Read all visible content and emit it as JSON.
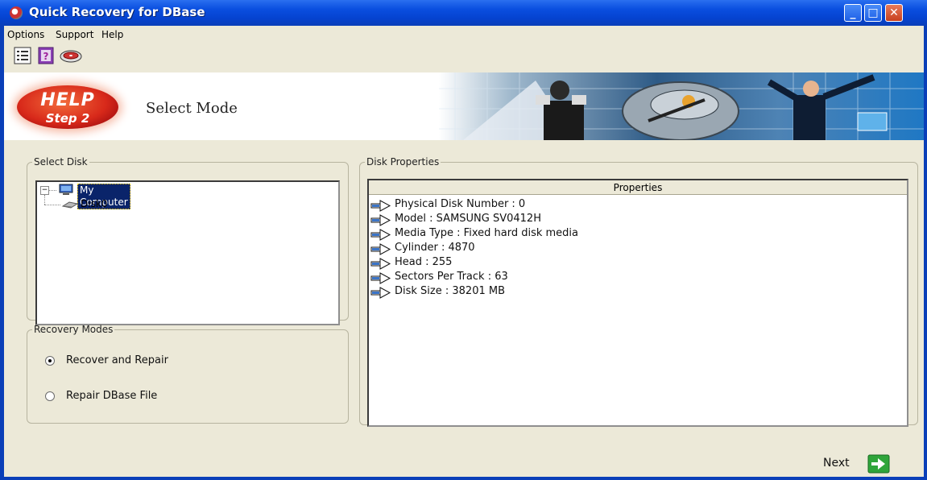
{
  "window": {
    "title": "Quick Recovery for DBase"
  },
  "menu": {
    "items": [
      "Options",
      "Support",
      "Help"
    ]
  },
  "toolbar": {
    "icons": [
      "list-icon",
      "help-book-icon",
      "disk-icon"
    ]
  },
  "banner": {
    "help_word": "HELP",
    "step_word": "Step 2",
    "mode_title": "Select Mode"
  },
  "select_disk": {
    "legend": "Select Disk",
    "tree_root": "My Computer",
    "tree_child": "Disk0"
  },
  "recovery_modes": {
    "legend": "Recovery Modes",
    "options": [
      {
        "label": "Recover and Repair",
        "checked": true
      },
      {
        "label": "Repair DBase File",
        "checked": false
      }
    ]
  },
  "disk_properties": {
    "legend": "Disk Properties",
    "header": "Properties",
    "rows": [
      "Physical Disk Number : 0",
      "Model   : SAMSUNG SV0412H",
      "Media Type   : Fixed hard disk media",
      "Cylinder   : 4870",
      "Head   : 255",
      "Sectors Per Track   : 63",
      "Disk Size  : 38201 MB"
    ]
  },
  "footer": {
    "next_label": "Next"
  }
}
